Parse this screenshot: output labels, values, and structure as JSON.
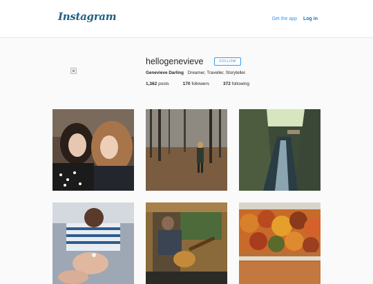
{
  "header": {
    "logo_text": "Instagram",
    "get_app_label": "Get the app",
    "login_label": "Log in"
  },
  "profile": {
    "username": "hellogenevieve",
    "follow_label": "FOLLOW",
    "full_name": "Genevieve Darling",
    "bio": "Dreamer, Traveller, Storyteller.",
    "posts_count": "1,362",
    "posts_label": "posts",
    "followers_count": "170",
    "followers_label": "followers",
    "following_count": "372",
    "following_label": "following"
  },
  "colors": {
    "accent": "#3897f0",
    "logo": "#1f5f84"
  }
}
